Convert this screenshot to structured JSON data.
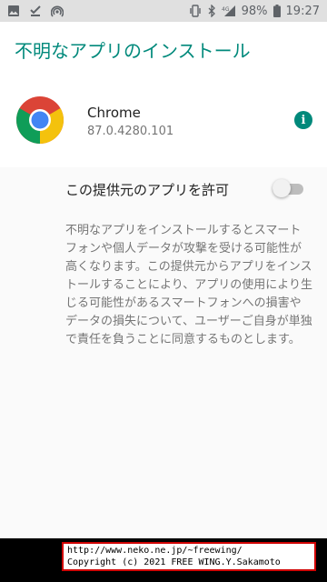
{
  "status_bar": {
    "left_icons": [
      "image-icon",
      "check-download-icon",
      "hotspot-icon"
    ],
    "right_icons": [
      "vibrate-icon",
      "bluetooth-icon",
      "signal-4g-icon",
      "battery-icon"
    ],
    "battery": "98%",
    "time": "19:27"
  },
  "header": {
    "title": "不明なアプリのインストール"
  },
  "app": {
    "name": "Chrome",
    "version": "87.0.4280.101"
  },
  "permission": {
    "label": "この提供元のアプリを許可",
    "enabled": false
  },
  "description": "不明なアプリをインストールするとスマートフォンや個人データが攻撃を受ける可能性が高くなります。この提供元からアプリをインストールすることにより、アプリの使用により生じる可能性があるスマートフォンへの損害やデータの損失について、ユーザーご自身が単独で責任を負うことに同意するものとします。",
  "watermark": {
    "line1": "http://www.neko.ne.jp/~freewing/",
    "line2": "Copyright (c) 2021 FREE WING.Y.Sakamoto"
  },
  "colors": {
    "accent": "#00897b",
    "status_bar_bg": "#e0e0e0",
    "nav_bar_bg": "#000000"
  }
}
